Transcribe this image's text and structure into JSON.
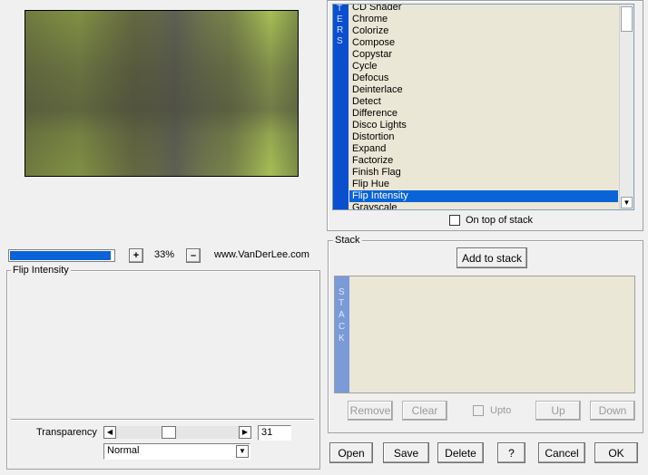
{
  "preview": {
    "image_name": "preview-image"
  },
  "zoom": {
    "plus_label": "+",
    "minus_label": "–",
    "value": "33%",
    "progress_fraction": 0.97
  },
  "website": "www.VanDerLee.com",
  "current_filter_title": "Flip Intensity",
  "filters": {
    "stripe_letters": [
      "T",
      "E",
      "R",
      "S"
    ],
    "items": [
      "CD Shader",
      "Chrome",
      "Colorize",
      "Compose",
      "Copystar",
      "Cycle",
      "Defocus",
      "Deinterlace",
      "Detect",
      "Difference",
      "Disco Lights",
      "Distortion",
      "Expand",
      "Factorize",
      "Finish Flag",
      "Flip Hue",
      "Flip Intensity",
      "Grayscale"
    ],
    "selected": "Flip Intensity",
    "on_top_label": "On top of stack"
  },
  "stack": {
    "title": "Stack",
    "add_label": "Add to stack",
    "stripe_letters": [
      "S",
      "T",
      "A",
      "C",
      "K"
    ],
    "remove_label": "Remove",
    "clear_label": "Clear",
    "upto_label": "Upto",
    "up_label": "Up",
    "down_label": "Down"
  },
  "transparency": {
    "label": "Transparency",
    "value": "31",
    "level_fraction": 0.31
  },
  "blend_mode": {
    "selected": "Normal"
  },
  "footer": {
    "open_label": "Open",
    "save_label": "Save",
    "delete_label": "Delete",
    "help_label": "?",
    "cancel_label": "Cancel",
    "ok_label": "OK"
  },
  "colors": {
    "selection": "#0a64d8",
    "list_bg": "#ebe7d6",
    "filter_stripe": "#0b4fcf",
    "stack_stripe": "#7a9ad8"
  }
}
